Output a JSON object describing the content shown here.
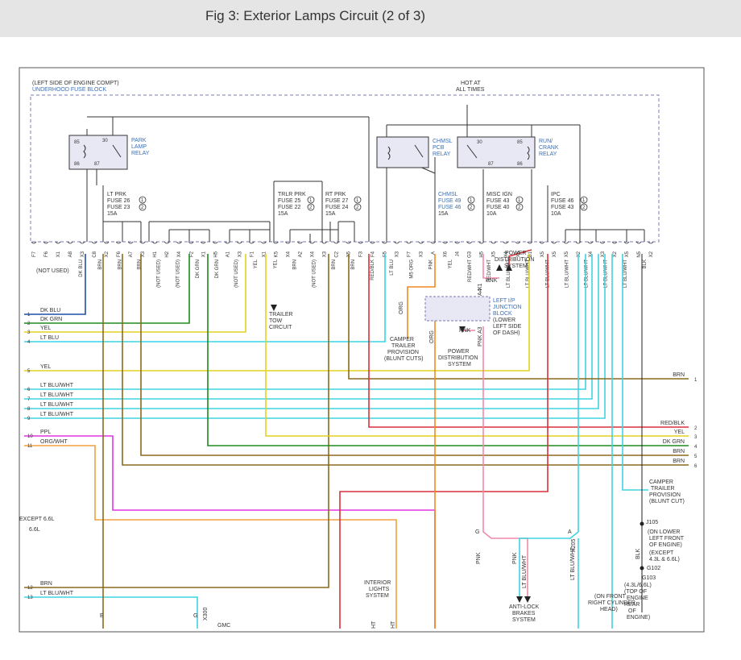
{
  "figure": {
    "title": "Fig 3: Exterior Lamps Circuit (2 of 3)"
  },
  "colors": {
    "dk_blu": "#1f4ea8",
    "dk_grn": "#1f8a1f",
    "yel": "#e3d21f",
    "lt_blu": "#33d6e6",
    "lt_blu_wht": "#3fd3e0",
    "brn": "#8a6a1e",
    "red_blk": "#d9323a",
    "ppl": "#e236e2",
    "org_wht": "#f0a040",
    "org": "#f08a20",
    "pnk": "#f08aa8",
    "blk": "#222222",
    "box_stroke": "#7a7ab8"
  },
  "fuse_block": {
    "title_line1": "(LEFT SIDE OF ENGINE COMPT)",
    "title_line2": "UNDERHOOD FUSE BLOCK",
    "hot_line1": "HOT AT",
    "hot_line2": "ALL TIMES"
  },
  "relays": {
    "park": [
      "PARK",
      "LAMP",
      "RELAY"
    ],
    "chmsl_pcb": [
      "CHMSL",
      "PCB",
      "RELAY"
    ],
    "run_crank": [
      "RUN/",
      "CRANK",
      "RELAY"
    ],
    "park_pins": [
      "85",
      "30",
      "86",
      "87"
    ],
    "run_pins": [
      "30",
      "85",
      "87",
      "86"
    ]
  },
  "fuses": {
    "lt_prk": [
      "LT PRK",
      "FUSE 26",
      "FUSE 23",
      "15A"
    ],
    "trlr_prk": [
      "TRLR PRK",
      "FUSE 25",
      "FUSE 22",
      "15A"
    ],
    "rt_prk": [
      "RT PRK",
      "FUSE 27",
      "FUSE 24",
      "15A"
    ],
    "chmsl": [
      "CHMSL",
      "FUSE 49",
      "FUSE 46",
      "15A"
    ],
    "misc_ign": [
      "MISC IGN",
      "FUSE 43",
      "FUSE 40",
      "10A"
    ],
    "ipc": [
      "IPC",
      "FUSE 46",
      "FUSE 43",
      "10A"
    ],
    "circ1": "1",
    "circ2": "2"
  },
  "pins": [
    "F7",
    "F6",
    "X1",
    "A8",
    "X3",
    "C8",
    "X2",
    "F6",
    "A7",
    "X3",
    "H1",
    "H2",
    "X4",
    "F2",
    "X1",
    "H5",
    "A1",
    "X3",
    "F1",
    "X1",
    "K5",
    "X4",
    "A2",
    "X4",
    "X3",
    "C2",
    "X5",
    "F3",
    "F4",
    "F5",
    "X3",
    "F7",
    "X3",
    "A",
    "X6",
    "J4",
    "G3",
    "H5",
    "X5",
    "X4",
    "X6",
    "B1",
    "X5",
    "X5",
    "X5",
    "X2",
    "X4",
    "X3",
    "X2",
    "X5",
    "N5",
    "X2"
  ],
  "not_used": "(NOT USED)",
  "wires_top": [
    "DK BLU",
    "BRN",
    "BRN",
    "BRN",
    "(NOT USED)",
    "(NOT USED)",
    "DK GRN",
    "DK GRN",
    "(NOT USED)",
    "YEL",
    "YEL",
    "BRN",
    "(NOT USED)",
    "BRN",
    "BRN",
    "RED/BLK",
    "LT BLU",
    "M5 ORG",
    "PNK",
    "YEL",
    "RED/WHT",
    "RED/WHT",
    "LT BLU/WHT",
    "LT BLU/WHT",
    "LT BLU/WHT",
    "LT BLU/WHT",
    "LT BLU/WHT",
    "LT BLU/WHT",
    "LT BLU/WHT",
    "BLK"
  ],
  "left_wires": [
    {
      "num": "1",
      "label": "DK BLU"
    },
    {
      "num": "2",
      "label": "DK GRN"
    },
    {
      "num": "3",
      "label": "YEL"
    },
    {
      "num": "4",
      "label": "LT BLU"
    },
    {
      "num": "5",
      "label": "YEL"
    },
    {
      "num": "6",
      "label": "LT BLU/WHT"
    },
    {
      "num": "7",
      "label": "LT BLU/WHT"
    },
    {
      "num": "8",
      "label": "LT BLU/WHT"
    },
    {
      "num": "9",
      "label": "LT BLU/WHT"
    },
    {
      "num": "10",
      "label": "PPL"
    },
    {
      "num": "11",
      "label": "ORG/WHT"
    },
    {
      "num": "12",
      "label": "BRN"
    },
    {
      "num": "13",
      "label": "LT BLU/WHT"
    }
  ],
  "right_wires": [
    {
      "num": "1",
      "label": "BRN"
    },
    {
      "num": "2",
      "label": "RED/BLK"
    },
    {
      "num": "3",
      "label": "YEL"
    },
    {
      "num": "4",
      "label": "DK GRN"
    },
    {
      "num": "5",
      "label": "BRN"
    },
    {
      "num": "6",
      "label": "BRN"
    }
  ],
  "labels": {
    "trailer_tow": [
      "TRAILER",
      "TOW",
      "CIRCUIT"
    ],
    "camper_blunt": [
      "CAMPER",
      "TRAILER",
      "PROVISION",
      "(BLUNT CUTS)"
    ],
    "camper_blunt_right": [
      "CAMPER",
      "TRAILER",
      "PROVISION",
      "(BLUNT CUT)"
    ],
    "pds_top": [
      "POWER",
      "DISTRIBUTION",
      "SYSTEM"
    ],
    "pds_bottom": [
      "POWER",
      "DISTRIBUTION",
      "SYSTEM"
    ],
    "ip_junction": [
      "LEFT I/P",
      "JUNCTION",
      "BLOCK",
      "(LOWER",
      "LEFT SIDE",
      "OF DASH)"
    ],
    "org": "ORG",
    "org3": "ORG",
    "pnk_a": "PNK",
    "pnk_b": "PNK",
    "pnk_c": "PNK",
    "x1": "X1",
    "a4": "A4",
    "a3": "A3",
    "j105": "J105",
    "j105_desc": [
      "(ON LOWER",
      "LEFT FRONT",
      "OF ENGINE)",
      "(EXCEPT",
      "4.3L & 6.6L)"
    ],
    "g102": "G102",
    "g103": "G103",
    "g_desc": [
      "(4.3L/6.6L)",
      "(TOP OF",
      "ENGINE",
      "REAR",
      "OF",
      "ENGINE)"
    ],
    "blk": "BLK",
    "except": "EXCEPT 6.6L",
    "six6l": "6.6L",
    "interior": [
      "INTERIOR",
      "LIGHTS",
      "SYSTEM"
    ],
    "abs": [
      "ANTI-LOCK",
      "BRAKES",
      "SYSTEM"
    ],
    "on_front": [
      "(ON FRONT",
      "RIGHT CYLINDER",
      "HEAD)"
    ],
    "x205": "X205",
    "x300": "X300",
    "g_pin": "G",
    "a_pin": "A",
    "e_pin": "E",
    "g_pin2": "G",
    "lt_blu_wht_v": "LT BLU/WHT",
    "pnk_v": "PNK",
    "pnk_v2": "PNK",
    "lt_blu_wht_v2": "LT BLU/WHT",
    "gmc": "GMC",
    "ht1": "HT",
    "ht2": "HT"
  }
}
